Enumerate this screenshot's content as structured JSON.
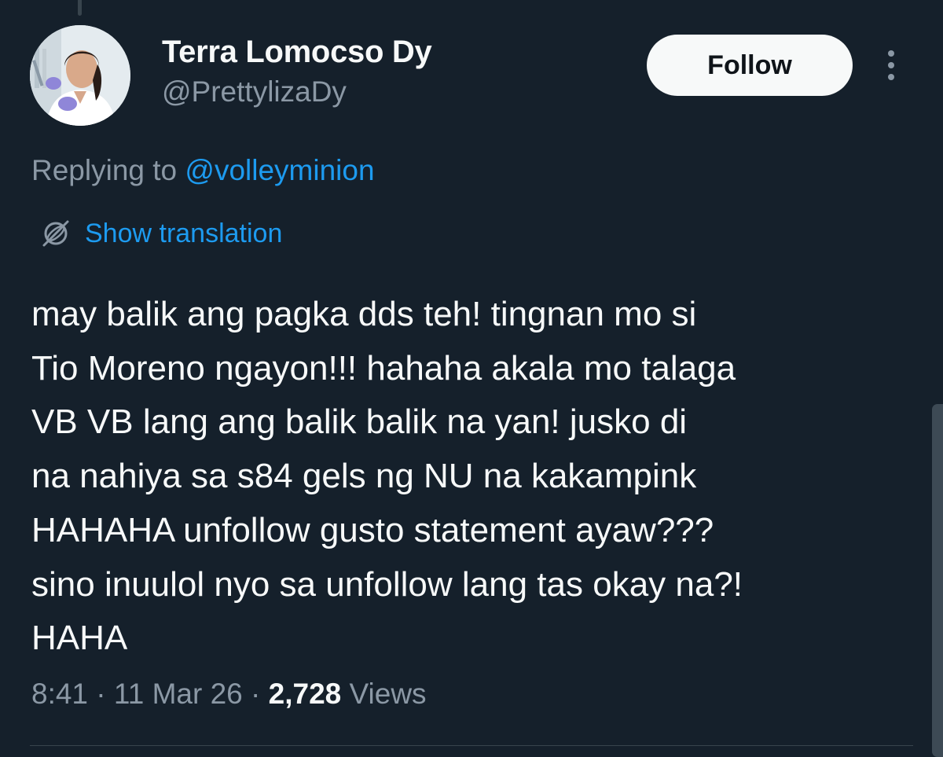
{
  "tweet": {
    "author": {
      "display_name": "Terra Lomocso Dy",
      "handle": "@PrettylizaDy",
      "avatar_icon": "profile-photo"
    },
    "follow_label": "Follow",
    "more_icon": "more-options-icon",
    "replying_prefix": "Replying to",
    "replying_to": "@volleyminion",
    "translation_label": "Show translation",
    "translation_icon": "globe-translate-icon",
    "text_lines": [
      "may balik ang pagka dds teh! tingnan mo si",
      "Tio Moreno ngayon!!! hahaha akala mo talaga",
      "VB VB lang ang balik balik na yan! jusko di",
      "na nahiya sa s84 gels ng NU na kakampink",
      "HAHAHA unfollow gusto statement ayaw???",
      "sino inuulol nyo sa unfollow lang tas okay na?!",
      "HAHA"
    ],
    "time": "8:41",
    "date": "11 Mar 26",
    "separator": "·",
    "views_count": "2,728",
    "views_label": "Views"
  },
  "colors": {
    "background": "#15202b",
    "accent": "#1d9bf0",
    "text_primary": "#f7f9f9",
    "text_secondary": "#8b98a5",
    "button_bg": "#f7f9f9",
    "button_text": "#0f1419"
  }
}
